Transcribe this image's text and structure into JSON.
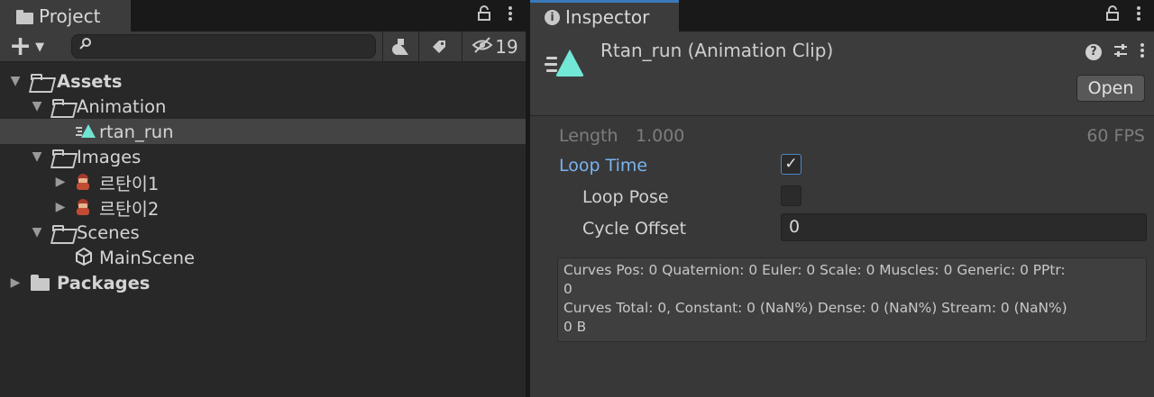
{
  "project": {
    "tab_label": "Project",
    "lock_icon": "lock-icon",
    "more_icon": "kebab-icon",
    "toolbar": {
      "add_icon": "plus-icon",
      "search_placeholder": "",
      "hidden_count": "19"
    },
    "tree": {
      "assets": "Assets",
      "animation": "Animation",
      "rtan_run": "rtan_run",
      "images": "Images",
      "image1": "르탄이1",
      "image2": "르탄이2",
      "scenes": "Scenes",
      "mainscene": "MainScene",
      "packages": "Packages"
    }
  },
  "inspector": {
    "tab_label": "Inspector",
    "clip_title": "Rtan_run (Animation Clip)",
    "open_label": "Open",
    "length_label": "Length",
    "length_value": "1.000",
    "fps_label": "60 FPS",
    "loop_time_label": "Loop Time",
    "loop_time_checked": true,
    "loop_pose_label": "Loop Pose",
    "loop_pose_checked": false,
    "cycle_offset_label": "Cycle Offset",
    "cycle_offset_value": "0",
    "info": {
      "line1": "Curves Pos: 0 Quaternion: 0 Euler: 0 Scale: 0 Muscles: 0 Generic: 0 PPtr:",
      "line2": "0",
      "line3": "Curves Total: 0, Constant: 0 (NaN%) Dense: 0 (NaN%) Stream: 0 (NaN%)",
      "line4": "0 B"
    }
  },
  "colors": {
    "accent_blue": "#79b3ef",
    "tab_highlight": "#3a79bb",
    "clip_teal": "#6fe4d3"
  }
}
